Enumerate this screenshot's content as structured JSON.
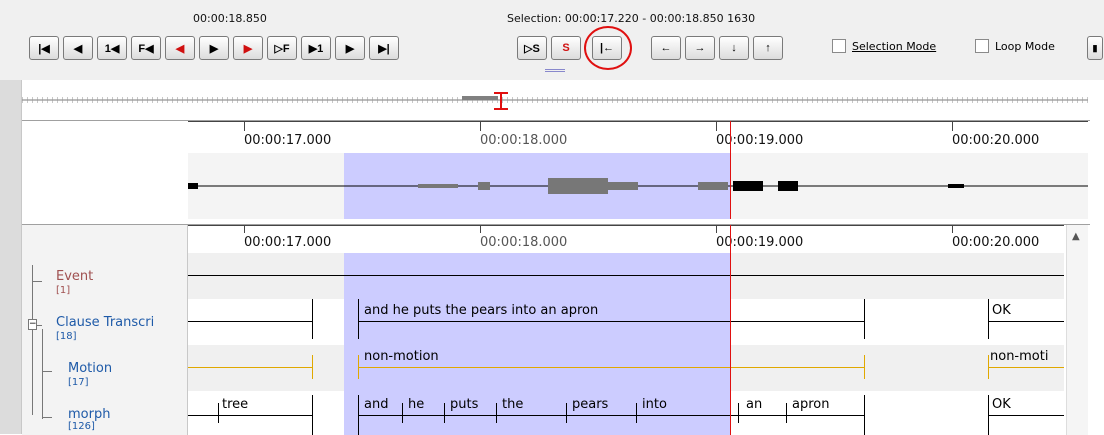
{
  "header": {
    "current_time": "00:00:18.850",
    "selection": "Selection: 00:00:17.220 - 00:00:18.850  1630"
  },
  "buttons": {
    "go_to_begin": "|◀",
    "prev_frame": "◀",
    "one_sec_back": "1◀",
    "f_back": "F◀",
    "prev_pixel": "◀",
    "play": "▶",
    "next_pixel": "▶",
    "f_fwd": "▷F",
    "one_sec_fwd": "▶1",
    "next_frame": "▶",
    "go_to_end": "▶|",
    "play_selection": "▷S",
    "clear_selection": "S",
    "selection_begin": "|←",
    "active_left": "←",
    "active_right": "→",
    "active_down": "↓",
    "active_up": "↑"
  },
  "checkboxes": {
    "selection_mode": "Selection Mode",
    "loop_mode": "Loop Mode"
  },
  "ruler": {
    "labels": [
      "00:00:17.000",
      "00:00:18.000",
      "00:00:19.000",
      "00:00:20.000"
    ]
  },
  "tiers": [
    {
      "name": "Event",
      "count": "[1]",
      "color": "#a05050"
    },
    {
      "name": "Clause Transcri",
      "count": "[18]",
      "color": "#1e5aa8"
    },
    {
      "name": "Motion",
      "count": "[17]",
      "color": "#1e5aa8"
    },
    {
      "name": "morph",
      "count": "[126]",
      "color": "#1e5aa8"
    }
  ],
  "annotations": {
    "clause": [
      "and he puts the pears into an apron",
      "OK"
    ],
    "motion": [
      "non-motion",
      "non-moti"
    ],
    "morph": [
      "tree",
      "and",
      "he",
      "puts",
      "the",
      "pears",
      "into",
      "an",
      "apron",
      "OK"
    ]
  },
  "colors": {
    "selection": "#ccccff",
    "cursor": "#e01010",
    "motion_line": "#e0a800",
    "highlight_circle": "#e01010"
  }
}
